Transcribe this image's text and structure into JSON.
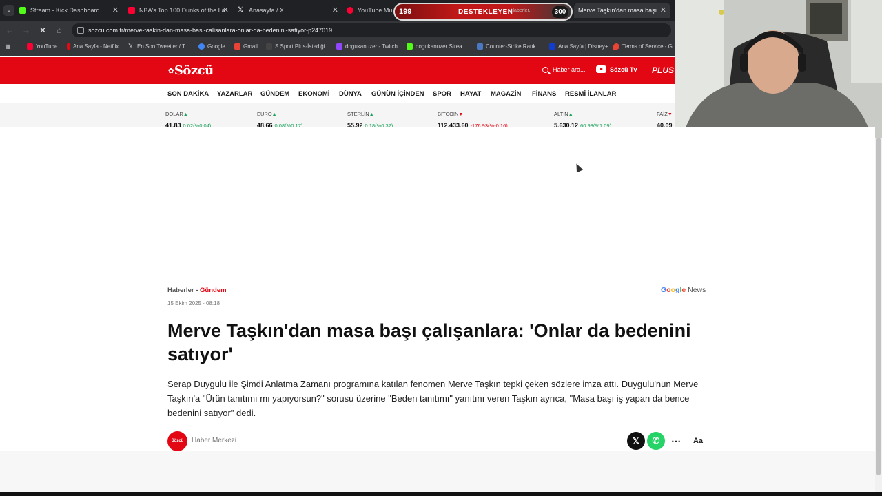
{
  "browser": {
    "tabs": [
      {
        "label": "Stream - Kick Dashboard",
        "color": "#53fc18"
      },
      {
        "label": "NBA's Top 100 Dunks of the La",
        "color": "#ff0033"
      },
      {
        "label": "Anasayfa / X",
        "color": "#ffffff"
      },
      {
        "label": "YouTube Mu",
        "color": "#ff0033"
      },
      {
        "label": "Merve Taşkın'dan masa başı ça",
        "color": "#e30613"
      }
    ],
    "url": "sozcu.com.tr/merve-taskin-dan-masa-basi-calisanlara-onlar-da-bedenini-satiyor-p247019",
    "bookmarks": [
      {
        "label": "YouTube",
        "color": "#ff0033"
      },
      {
        "label": "Ana Sayfa - Netflix",
        "color": "#e50914"
      },
      {
        "label": "En Son Tweetler / T...",
        "color": "#ffffff"
      },
      {
        "label": "Google",
        "color": "#4285f4"
      },
      {
        "label": "Gmail",
        "color": "#ea4335"
      },
      {
        "label": "S Sport Plus-İstediği...",
        "color": "#444444"
      },
      {
        "label": "dogukanuzer - Twitch",
        "color": "#9146ff"
      },
      {
        "label": "dogukanuzer Strea...",
        "color": "#53fc18"
      },
      {
        "label": "Counter-Strike Rank...",
        "color": "#4a78c2"
      },
      {
        "label": "Ana Sayfa | Disney+",
        "color": "#113ccf"
      },
      {
        "label": "Terms of Service - G...",
        "color": "#ea4335"
      }
    ]
  },
  "widget": {
    "left_count": "199",
    "label": "DESTEKLEYEN",
    "extra": "Haberler,",
    "right_count": "300"
  },
  "site": {
    "logo": "Sözcü",
    "search": "Haber ara...",
    "tv": "Sözcü Tv",
    "plus": "PLUS",
    "nav": [
      "SON DAKİKA",
      "YAZARLAR",
      "GÜNDEM",
      "EKONOMİ",
      "DÜNYA",
      "GÜNÜN İÇİNDEN",
      "SPOR",
      "HAYAT",
      "MAGAZİN",
      "FİNANS",
      "RESMİ İLANLAR"
    ],
    "ticker": [
      {
        "name": "DOLAR",
        "dir": "up",
        "value": "41,83",
        "change": "0,02(%0,04)"
      },
      {
        "name": "EURO",
        "dir": "up",
        "value": "48,66",
        "change": "0,08(%0,17)"
      },
      {
        "name": "STERLİN",
        "dir": "up",
        "value": "55,92",
        "change": "0,18(%0,32)"
      },
      {
        "name": "BITCOIN",
        "dir": "down",
        "value": "112.433,60",
        "change": "-176,93(%-0,16)"
      },
      {
        "name": "ALTIN",
        "dir": "up",
        "value": "5.630,12",
        "change": "60,93(%1,09)"
      },
      {
        "name": "FAİZ",
        "dir": "down",
        "value": "40,09",
        "change": ""
      }
    ]
  },
  "article": {
    "breadcrumb_1": "Haberler",
    "breadcrumb_sep": " - ",
    "breadcrumb_2": "Gündem",
    "date": "15 Ekim 2025 - 08:18",
    "gnews_google": "Google",
    "gnews_news": " News",
    "title": "Merve Taşkın'dan masa başı çalışanlara: 'Onlar da bedenini satıyor'",
    "lead": "Serap Duygulu ile Şimdi Anlatma Zamanı programına katılan fenomen Merve Taşkın tepki çeken sözlere imza attı. Duygulu'nun Merve Taşkın'a \"Ürün tanıtımı mı yapıyorsun?\" sorusu üzerine \"Beden tanıtımı\" yanıtını veren Taşkın ayrıca, \"Masa başı iş yapan da bence bedenini satıyor\" dedi.",
    "author": "Haber Merkezi",
    "avatar_text": "Sözcü"
  }
}
